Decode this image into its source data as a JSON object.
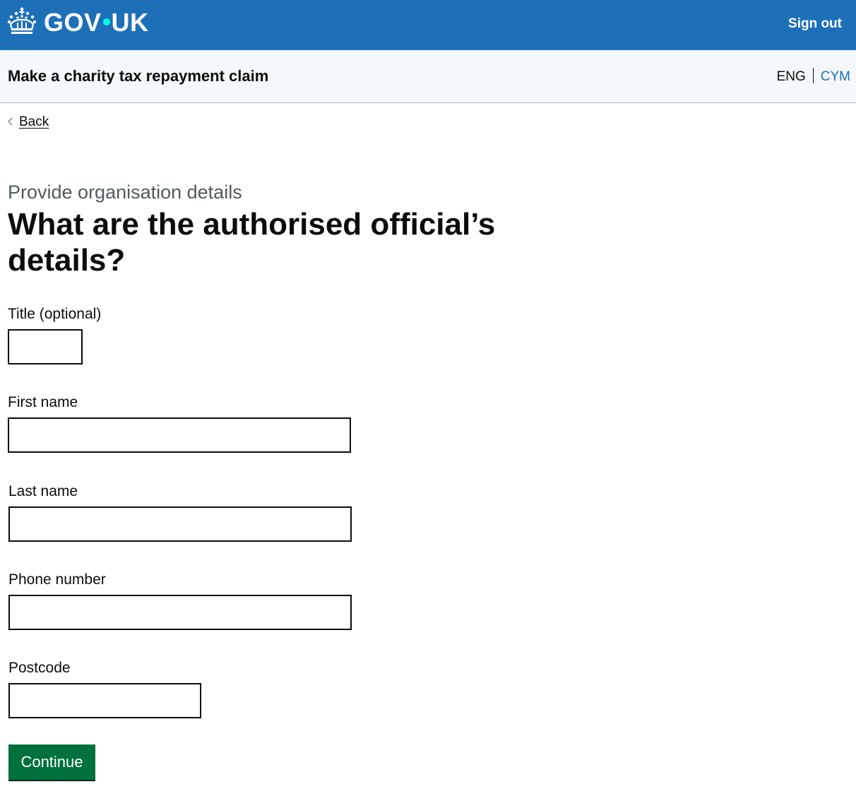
{
  "header": {
    "logo_text_left": "GOV",
    "logo_text_right": "UK",
    "sign_out_label": "Sign out",
    "crown_icon": "crown-icon"
  },
  "service": {
    "name": "Make a charity tax repayment claim",
    "lang_current": "ENG",
    "lang_other": "CYM"
  },
  "back_link": {
    "label": "Back",
    "icon": "chevron-left-icon"
  },
  "page": {
    "caption": "Provide organisation details",
    "heading": "What are the authorised official’s details?"
  },
  "form": {
    "fields": [
      {
        "label": "Title (optional)",
        "value": ""
      },
      {
        "label": "First name",
        "value": ""
      },
      {
        "label": "Last name",
        "value": ""
      },
      {
        "label": "Phone number",
        "value": ""
      },
      {
        "label": "Postcode",
        "value": ""
      }
    ],
    "continue_label": "Continue"
  },
  "colors": {
    "header_blue": "#1d70b8",
    "logo_dot": "#00ffe0",
    "service_bar": "#f4f8fb",
    "link_blue": "#1d70b8",
    "button_green": "#00703c",
    "text": "#0b0c0c",
    "secondary_text": "#505a5f"
  }
}
